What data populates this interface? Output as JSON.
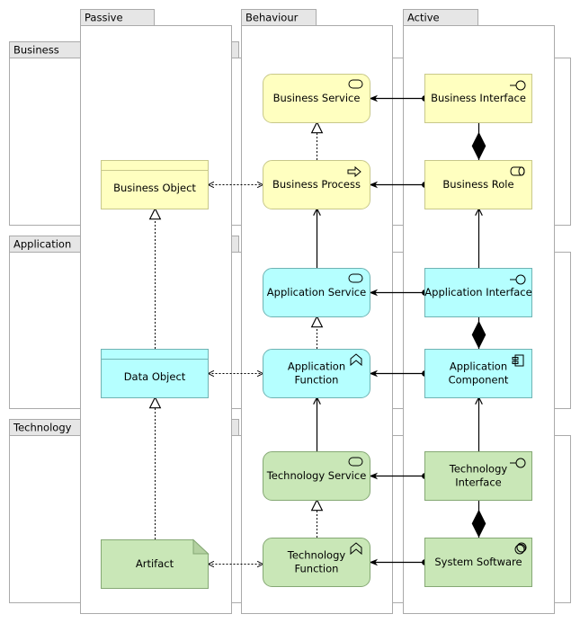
{
  "colors": {
    "business_fill": "#ffffc0",
    "business_stroke": "#c8c88a",
    "application_fill": "#b5ffff",
    "application_stroke": "#6fb3b3",
    "technology_fill": "#c9e7b7",
    "technology_stroke": "#85a874",
    "group_tab": "#e6e6e6",
    "group_border": "#aaaaaa"
  },
  "rows": [
    {
      "id": "business",
      "label": "Business"
    },
    {
      "id": "application",
      "label": "Application"
    },
    {
      "id": "technology",
      "label": "Technology"
    }
  ],
  "columns": [
    {
      "id": "passive",
      "label": "Passive"
    },
    {
      "id": "behaviour",
      "label": "Behaviour"
    },
    {
      "id": "active",
      "label": "Active"
    }
  ],
  "elements": {
    "business_service": {
      "label": [
        "Business Service"
      ],
      "icon": "service-icon",
      "layer": "business"
    },
    "business_interface": {
      "label": [
        "Business Interface"
      ],
      "icon": "interface-icon",
      "layer": "business"
    },
    "business_object": {
      "label": [
        "Business Object"
      ],
      "icon": "object",
      "layer": "business"
    },
    "business_process": {
      "label": [
        "Business Process"
      ],
      "icon": "process-arrow-icon",
      "layer": "business"
    },
    "business_role": {
      "label": [
        "Business Role"
      ],
      "icon": "role-icon",
      "layer": "business"
    },
    "application_service": {
      "label": [
        "Application Service"
      ],
      "icon": "service-icon",
      "layer": "application"
    },
    "application_interface": {
      "label": [
        "Application Interface"
      ],
      "icon": "interface-icon",
      "layer": "application"
    },
    "data_object": {
      "label": [
        "Data Object"
      ],
      "icon": "object",
      "layer": "application"
    },
    "application_function": {
      "label": [
        "Application",
        "Function"
      ],
      "icon": "function-icon",
      "layer": "application"
    },
    "application_component": {
      "label": [
        "Application",
        "Component"
      ],
      "icon": "component-icon",
      "layer": "application"
    },
    "technology_service": {
      "label": [
        "Technology Service"
      ],
      "icon": "service-icon",
      "layer": "technology"
    },
    "technology_interface": {
      "label": [
        "Technology",
        "Interface"
      ],
      "icon": "interface-icon",
      "layer": "technology"
    },
    "artifact": {
      "label": [
        "Artifact"
      ],
      "icon": "artifact",
      "layer": "technology"
    },
    "technology_function": {
      "label": [
        "Technology",
        "Function"
      ],
      "icon": "function-icon",
      "layer": "technology"
    },
    "system_software": {
      "label": [
        "System Software"
      ],
      "icon": "system-software-icon",
      "layer": "technology"
    }
  },
  "relationships": [
    {
      "type": "assignment",
      "from": "business_interface",
      "to": "business_service"
    },
    {
      "type": "assignment",
      "from": "business_role",
      "to": "business_process"
    },
    {
      "type": "composition",
      "from": "business_role",
      "to": "business_interface"
    },
    {
      "type": "realization",
      "from": "business_process",
      "to": "business_service"
    },
    {
      "type": "access",
      "from": "business_process",
      "to": "business_object"
    },
    {
      "type": "assignment",
      "from": "application_interface",
      "to": "application_service"
    },
    {
      "type": "assignment",
      "from": "application_component",
      "to": "application_function"
    },
    {
      "type": "composition",
      "from": "application_component",
      "to": "application_interface"
    },
    {
      "type": "realization",
      "from": "application_function",
      "to": "application_service"
    },
    {
      "type": "access",
      "from": "application_function",
      "to": "data_object"
    },
    {
      "type": "serving",
      "from": "application_service",
      "to": "business_process"
    },
    {
      "type": "serving",
      "from": "application_interface",
      "to": "business_role"
    },
    {
      "type": "realization",
      "from": "data_object",
      "to": "business_object"
    },
    {
      "type": "assignment",
      "from": "technology_interface",
      "to": "technology_service"
    },
    {
      "type": "assignment",
      "from": "system_software",
      "to": "technology_function"
    },
    {
      "type": "composition",
      "from": "system_software",
      "to": "technology_interface"
    },
    {
      "type": "realization",
      "from": "technology_function",
      "to": "technology_service"
    },
    {
      "type": "access",
      "from": "technology_function",
      "to": "artifact"
    },
    {
      "type": "serving",
      "from": "technology_service",
      "to": "application_function"
    },
    {
      "type": "serving",
      "from": "technology_interface",
      "to": "application_component"
    },
    {
      "type": "realization",
      "from": "artifact",
      "to": "data_object"
    }
  ]
}
